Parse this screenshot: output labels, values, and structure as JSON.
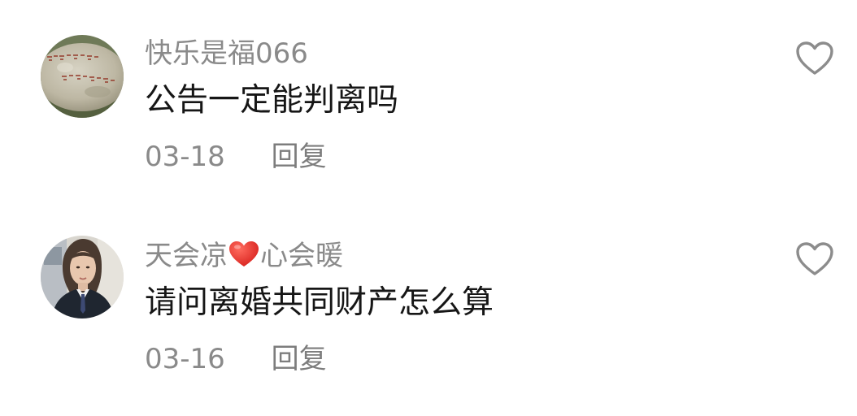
{
  "comments": [
    {
      "username": "快乐是福066",
      "avatar_icon": "stone-inscription-avatar",
      "content": "公告一定能判离吗",
      "date": "03-18",
      "reply_label": "回复",
      "like_icon": "heart-outline-icon"
    },
    {
      "username_before": "天会凉",
      "username_emoji": "red-heart-emoji",
      "username_after": "心会暖",
      "avatar_icon": "portrait-photo-avatar",
      "content": "请问离婚共同财产怎么算",
      "date": "03-16",
      "reply_label": "回复",
      "like_icon": "heart-outline-icon"
    }
  ],
  "colors": {
    "secondary_text": "#8a8a8a",
    "primary_text": "#161616",
    "emoji_heart": "#e0322d",
    "like_icon_stroke": "#8c8c8c"
  }
}
